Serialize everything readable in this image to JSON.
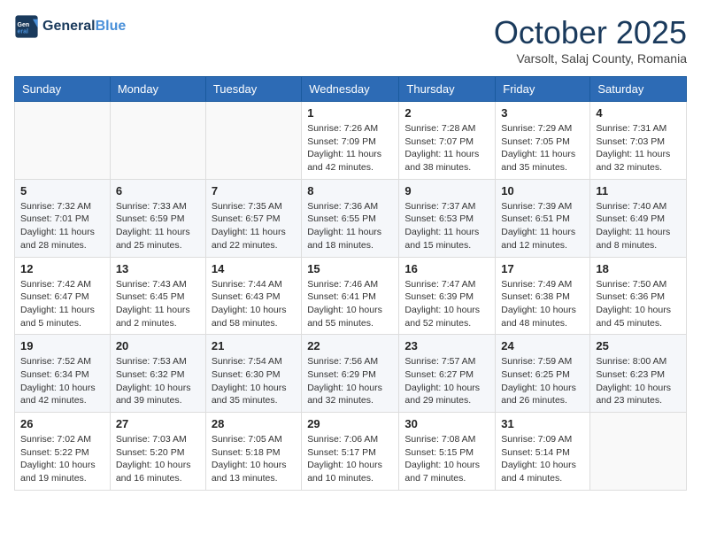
{
  "header": {
    "logo_line1": "General",
    "logo_line2": "Blue",
    "month_year": "October 2025",
    "location": "Varsolt, Salaj County, Romania"
  },
  "days_of_week": [
    "Sunday",
    "Monday",
    "Tuesday",
    "Wednesday",
    "Thursday",
    "Friday",
    "Saturday"
  ],
  "weeks": [
    [
      {
        "day": "",
        "info": ""
      },
      {
        "day": "",
        "info": ""
      },
      {
        "day": "",
        "info": ""
      },
      {
        "day": "1",
        "info": "Sunrise: 7:26 AM\nSunset: 7:09 PM\nDaylight: 11 hours and 42 minutes."
      },
      {
        "day": "2",
        "info": "Sunrise: 7:28 AM\nSunset: 7:07 PM\nDaylight: 11 hours and 38 minutes."
      },
      {
        "day": "3",
        "info": "Sunrise: 7:29 AM\nSunset: 7:05 PM\nDaylight: 11 hours and 35 minutes."
      },
      {
        "day": "4",
        "info": "Sunrise: 7:31 AM\nSunset: 7:03 PM\nDaylight: 11 hours and 32 minutes."
      }
    ],
    [
      {
        "day": "5",
        "info": "Sunrise: 7:32 AM\nSunset: 7:01 PM\nDaylight: 11 hours and 28 minutes."
      },
      {
        "day": "6",
        "info": "Sunrise: 7:33 AM\nSunset: 6:59 PM\nDaylight: 11 hours and 25 minutes."
      },
      {
        "day": "7",
        "info": "Sunrise: 7:35 AM\nSunset: 6:57 PM\nDaylight: 11 hours and 22 minutes."
      },
      {
        "day": "8",
        "info": "Sunrise: 7:36 AM\nSunset: 6:55 PM\nDaylight: 11 hours and 18 minutes."
      },
      {
        "day": "9",
        "info": "Sunrise: 7:37 AM\nSunset: 6:53 PM\nDaylight: 11 hours and 15 minutes."
      },
      {
        "day": "10",
        "info": "Sunrise: 7:39 AM\nSunset: 6:51 PM\nDaylight: 11 hours and 12 minutes."
      },
      {
        "day": "11",
        "info": "Sunrise: 7:40 AM\nSunset: 6:49 PM\nDaylight: 11 hours and 8 minutes."
      }
    ],
    [
      {
        "day": "12",
        "info": "Sunrise: 7:42 AM\nSunset: 6:47 PM\nDaylight: 11 hours and 5 minutes."
      },
      {
        "day": "13",
        "info": "Sunrise: 7:43 AM\nSunset: 6:45 PM\nDaylight: 11 hours and 2 minutes."
      },
      {
        "day": "14",
        "info": "Sunrise: 7:44 AM\nSunset: 6:43 PM\nDaylight: 10 hours and 58 minutes."
      },
      {
        "day": "15",
        "info": "Sunrise: 7:46 AM\nSunset: 6:41 PM\nDaylight: 10 hours and 55 minutes."
      },
      {
        "day": "16",
        "info": "Sunrise: 7:47 AM\nSunset: 6:39 PM\nDaylight: 10 hours and 52 minutes."
      },
      {
        "day": "17",
        "info": "Sunrise: 7:49 AM\nSunset: 6:38 PM\nDaylight: 10 hours and 48 minutes."
      },
      {
        "day": "18",
        "info": "Sunrise: 7:50 AM\nSunset: 6:36 PM\nDaylight: 10 hours and 45 minutes."
      }
    ],
    [
      {
        "day": "19",
        "info": "Sunrise: 7:52 AM\nSunset: 6:34 PM\nDaylight: 10 hours and 42 minutes."
      },
      {
        "day": "20",
        "info": "Sunrise: 7:53 AM\nSunset: 6:32 PM\nDaylight: 10 hours and 39 minutes."
      },
      {
        "day": "21",
        "info": "Sunrise: 7:54 AM\nSunset: 6:30 PM\nDaylight: 10 hours and 35 minutes."
      },
      {
        "day": "22",
        "info": "Sunrise: 7:56 AM\nSunset: 6:29 PM\nDaylight: 10 hours and 32 minutes."
      },
      {
        "day": "23",
        "info": "Sunrise: 7:57 AM\nSunset: 6:27 PM\nDaylight: 10 hours and 29 minutes."
      },
      {
        "day": "24",
        "info": "Sunrise: 7:59 AM\nSunset: 6:25 PM\nDaylight: 10 hours and 26 minutes."
      },
      {
        "day": "25",
        "info": "Sunrise: 8:00 AM\nSunset: 6:23 PM\nDaylight: 10 hours and 23 minutes."
      }
    ],
    [
      {
        "day": "26",
        "info": "Sunrise: 7:02 AM\nSunset: 5:22 PM\nDaylight: 10 hours and 19 minutes."
      },
      {
        "day": "27",
        "info": "Sunrise: 7:03 AM\nSunset: 5:20 PM\nDaylight: 10 hours and 16 minutes."
      },
      {
        "day": "28",
        "info": "Sunrise: 7:05 AM\nSunset: 5:18 PM\nDaylight: 10 hours and 13 minutes."
      },
      {
        "day": "29",
        "info": "Sunrise: 7:06 AM\nSunset: 5:17 PM\nDaylight: 10 hours and 10 minutes."
      },
      {
        "day": "30",
        "info": "Sunrise: 7:08 AM\nSunset: 5:15 PM\nDaylight: 10 hours and 7 minutes."
      },
      {
        "day": "31",
        "info": "Sunrise: 7:09 AM\nSunset: 5:14 PM\nDaylight: 10 hours and 4 minutes."
      },
      {
        "day": "",
        "info": ""
      }
    ]
  ]
}
